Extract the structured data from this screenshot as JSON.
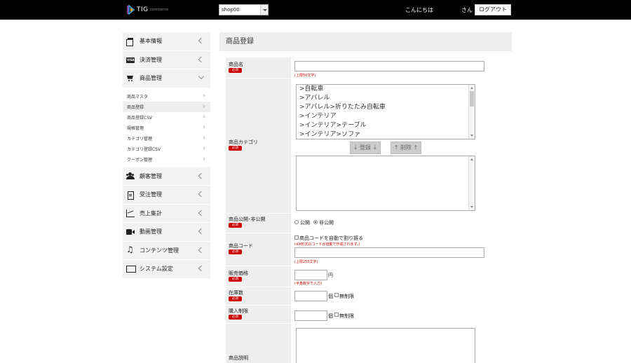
{
  "header": {
    "brand": "TIG",
    "brand_sub": "commerce",
    "shop_selected": "shop00",
    "greeting": "こんにちは",
    "honorific": "さん",
    "logout_label": "ログアウト"
  },
  "sidebar": {
    "items": [
      {
        "label": "基本情報",
        "icon": "documents-icon"
      },
      {
        "label": "決済管理",
        "icon": "visa-card-icon"
      },
      {
        "label": "商品管理",
        "icon": "cart-icon"
      },
      {
        "label": "顧客管理",
        "icon": "users-icon"
      },
      {
        "label": "受注管理",
        "icon": "file-icon"
      },
      {
        "label": "売上集計",
        "icon": "line-chart-icon"
      },
      {
        "label": "動画管理",
        "icon": "video-camera-icon"
      },
      {
        "label": "コンテンツ管理",
        "icon": "music-note-icon"
      },
      {
        "label": "システム設定",
        "icon": "monitor-icon"
      }
    ],
    "sub_items": [
      {
        "label": "商品マスタ"
      },
      {
        "label": "商品登録"
      },
      {
        "label": "商品登録CSV"
      },
      {
        "label": "規格管理"
      },
      {
        "label": "カテゴリ管理"
      },
      {
        "label": "カテゴリ登録CSV"
      },
      {
        "label": "クーポン管理"
      }
    ]
  },
  "page": {
    "title": "商品登録",
    "required": "必須",
    "fields": {
      "name": {
        "label": "商品名",
        "hint": "(上限50文字)"
      },
      "category": {
        "label": "商品カテゴリ",
        "options": [
          ">自転車",
          ">アパレル",
          ">アパレル>折りたたみ自転車",
          ">インテリア",
          ">インテリア>テーブル",
          ">インテリア>ソファ"
        ],
        "register_label": "↓ 登録 ↓",
        "delete_label": "↑ 削除 ↑"
      },
      "visibility": {
        "label": "商品公開･非公開",
        "public": "公開",
        "private": "非公開",
        "selected": "private"
      },
      "code": {
        "label": "商品コード",
        "auto_label": "商品コードを自動で割り振る",
        "auto_hint": "(※A形式のコードが自動で作成されます。)",
        "hint": "(上限255文字)"
      },
      "price": {
        "label": "販売価格",
        "unit": "円",
        "hint": "(半角数字で入力)"
      },
      "stock": {
        "label": "在庫数",
        "unit": "個",
        "unlimited": "無制限"
      },
      "limit": {
        "label": "購入制限",
        "unit": "個",
        "unlimited": "無制限"
      },
      "description": {
        "label": "商品説明"
      }
    }
  }
}
